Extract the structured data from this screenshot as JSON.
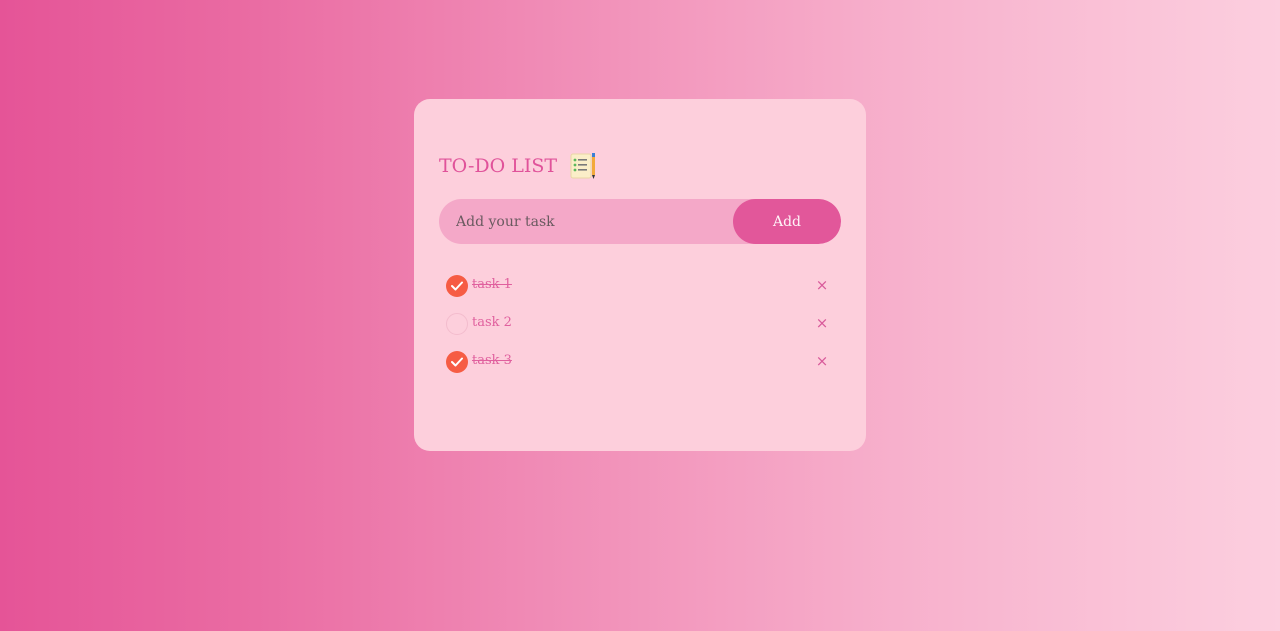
{
  "app": {
    "title": "TO-DO LIST",
    "title_icon": "checklist-pencil-icon"
  },
  "input": {
    "placeholder": "Add your task",
    "value": ""
  },
  "add_button": {
    "label": "Add"
  },
  "tasks": [
    {
      "text": "task 1",
      "done": true,
      "delete_label": "×"
    },
    {
      "text": "task 2",
      "done": false,
      "delete_label": "×"
    },
    {
      "text": "task 3",
      "done": true,
      "delete_label": "×"
    }
  ],
  "colors": {
    "accent": "#e2579a",
    "check_done": "#f65c44",
    "card": "#fdcfdc"
  }
}
